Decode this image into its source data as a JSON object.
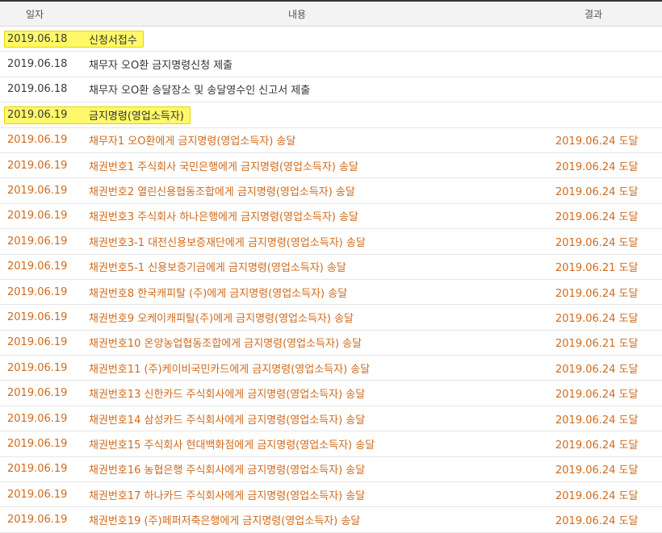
{
  "headers": {
    "date": "일자",
    "content": "내용",
    "result": "결과"
  },
  "rows": [
    {
      "date": "2019.06.18",
      "content": "신청서접수",
      "result": "",
      "highlight": true,
      "style": "dark"
    },
    {
      "date": "2019.06.18",
      "content": "채무자 오O환 금지명령신청 제출",
      "result": "",
      "highlight": false,
      "style": "dark"
    },
    {
      "date": "2019.06.18",
      "content": "채무자 오O환 송달장소 및 송달영수인 신고서 제출",
      "result": "",
      "highlight": false,
      "style": "dark"
    },
    {
      "date": "2019.06.19",
      "content": "금지명령(영업소득자)",
      "result": "",
      "highlight": true,
      "style": "dark"
    },
    {
      "date": "2019.06.19",
      "content": "채무자1 오O환에게 금지명령(영업소득자) 송달",
      "result": "2019.06.24 도달",
      "highlight": false,
      "style": "orange"
    },
    {
      "date": "2019.06.19",
      "content": "채권번호1 주식회사 국민은행에게 금지명령(영업소득자) 송달",
      "result": "2019.06.24 도달",
      "highlight": false,
      "style": "orange"
    },
    {
      "date": "2019.06.19",
      "content": "채권번호2 열린신용협동조합에게 금지명령(영업소득자) 송달",
      "result": "2019.06.24 도달",
      "highlight": false,
      "style": "orange"
    },
    {
      "date": "2019.06.19",
      "content": "채권번호3 주식회사 하나은행에게 금지명령(영업소득자) 송달",
      "result": "2019.06.24 도달",
      "highlight": false,
      "style": "orange"
    },
    {
      "date": "2019.06.19",
      "content": "채권번호3-1 대전신용보증재단에게 금지명령(영업소득자) 송달",
      "result": "2019.06.24 도달",
      "highlight": false,
      "style": "orange"
    },
    {
      "date": "2019.06.19",
      "content": "채권번호5-1 신용보증기금에게 금지명령(영업소득자) 송달",
      "result": "2019.06.21 도달",
      "highlight": false,
      "style": "orange"
    },
    {
      "date": "2019.06.19",
      "content": "채권번호8 한국캐피탈 (주)에게 금지명령(영업소득자) 송달",
      "result": "2019.06.24 도달",
      "highlight": false,
      "style": "orange"
    },
    {
      "date": "2019.06.19",
      "content": "채권번호9 오케이캐피탈(주)에게 금지명령(영업소득자) 송달",
      "result": "2019.06.24 도달",
      "highlight": false,
      "style": "orange"
    },
    {
      "date": "2019.06.19",
      "content": "채권번호10 온양농업협동조합에게 금지명령(영업소득자) 송달",
      "result": "2019.06.21 도달",
      "highlight": false,
      "style": "orange"
    },
    {
      "date": "2019.06.19",
      "content": "채권번호11 (주)케이비국민카드에게 금지명령(영업소득자) 송달",
      "result": "2019.06.24 도달",
      "highlight": false,
      "style": "orange"
    },
    {
      "date": "2019.06.19",
      "content": "채권번호13 신한카드 주식회사에게 금지명령(영업소득자) 송달",
      "result": "2019.06.24 도달",
      "highlight": false,
      "style": "orange"
    },
    {
      "date": "2019.06.19",
      "content": "채권번호14 삼성카드 주식회사에게 금지명령(영업소득자) 송달",
      "result": "2019.06.24 도달",
      "highlight": false,
      "style": "orange"
    },
    {
      "date": "2019.06.19",
      "content": "채권번호15 주식회사 현대백화점에게 금지명령(영업소득자) 송달",
      "result": "2019.06.24 도달",
      "highlight": false,
      "style": "orange"
    },
    {
      "date": "2019.06.19",
      "content": "채권번호16 농협은행 주식회사에게 금지명령(영업소득자) 송달",
      "result": "2019.06.24 도달",
      "highlight": false,
      "style": "orange"
    },
    {
      "date": "2019.06.19",
      "content": "채권번호17 하나카드 주식회사에게 금지명령(영업소득자) 송달",
      "result": "2019.06.24 도달",
      "highlight": false,
      "style": "orange"
    },
    {
      "date": "2019.06.19",
      "content": "채권번호19 (주)페퍼저축은행에게 금지명령(영업소득자) 송달",
      "result": "2019.06.24 도달",
      "highlight": false,
      "style": "orange"
    }
  ]
}
